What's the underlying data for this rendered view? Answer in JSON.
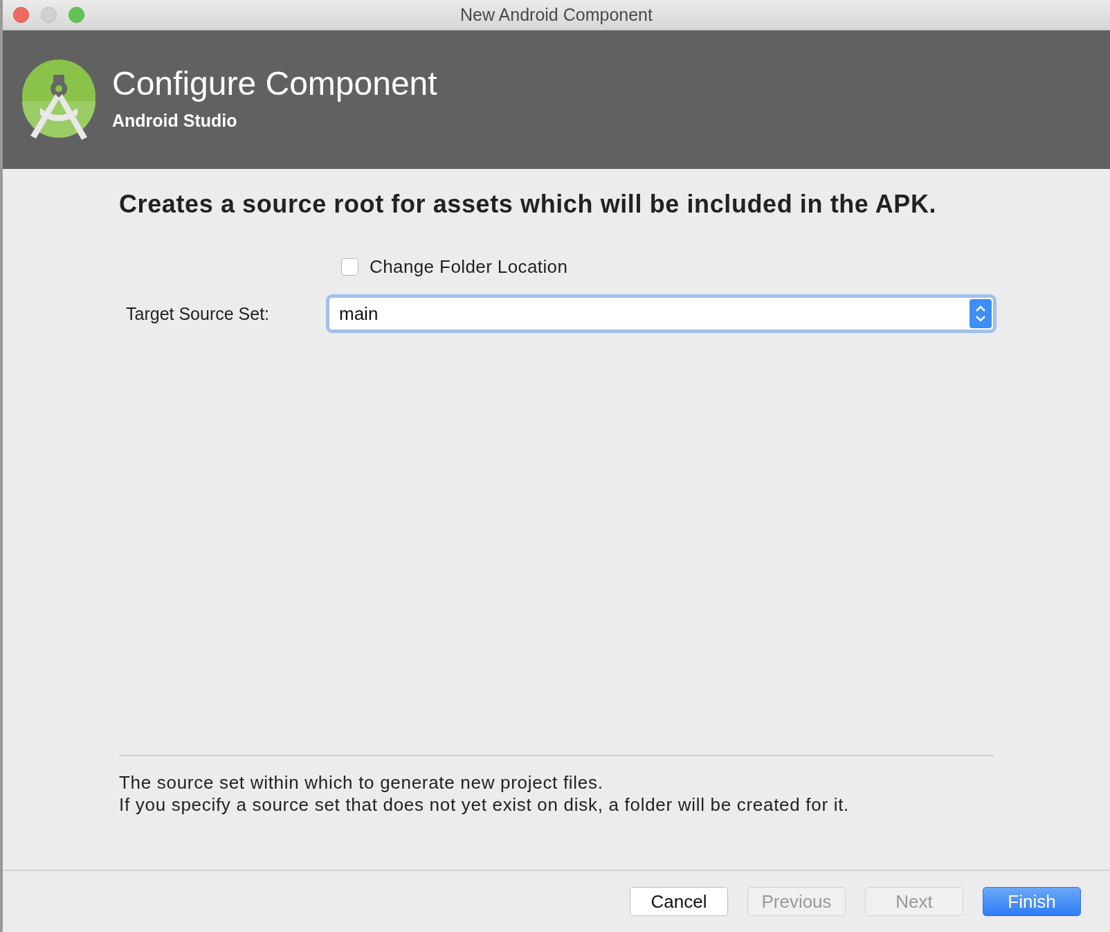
{
  "window": {
    "title": "New Android Component"
  },
  "header": {
    "title": "Configure Component",
    "subtitle": "Android Studio"
  },
  "description": "Creates a source root for assets which will be included in the APK.",
  "change_folder_location": {
    "label": "Change Folder Location",
    "checked": false
  },
  "target_source_set": {
    "label": "Target Source Set:",
    "value": "main",
    "focused": true
  },
  "help_lines": [
    "The source set within which to generate new project files.",
    "If you specify a source set that does not yet exist on disk, a folder will be created for it."
  ],
  "buttons": [
    {
      "label": "Cancel",
      "kind": "normal",
      "disabled": false
    },
    {
      "label": "Previous",
      "kind": "normal",
      "disabled": true
    },
    {
      "label": "Next",
      "kind": "normal",
      "disabled": true
    },
    {
      "label": "Finish",
      "kind": "default",
      "disabled": false
    }
  ]
}
